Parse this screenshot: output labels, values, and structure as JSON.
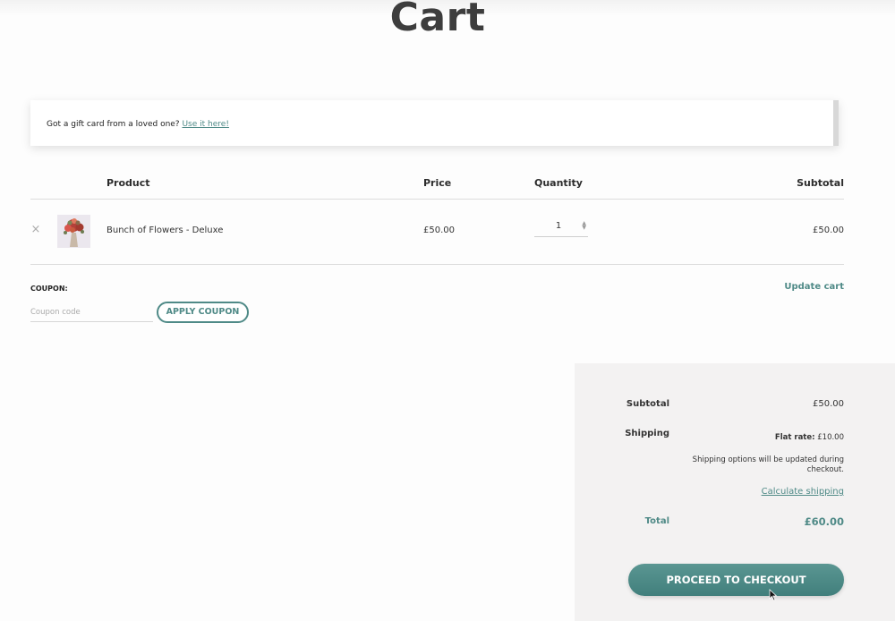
{
  "page": {
    "title": "Cart"
  },
  "notice": {
    "text": "Got a gift card from a loved one?",
    "link": "Use it here!"
  },
  "table": {
    "headers": {
      "product": "Product",
      "price": "Price",
      "quantity": "Quantity",
      "subtotal": "Subtotal"
    },
    "rows": [
      {
        "remove": "×",
        "image_icon": "flower-bouquet-thumbnail",
        "product": "Bunch of Flowers - Deluxe",
        "price": "£50.00",
        "quantity": "1",
        "subtotal": "£50.00"
      }
    ]
  },
  "coupon": {
    "label": "COUPON:",
    "placeholder": "Coupon code",
    "apply_label": "APPLY COUPON"
  },
  "update_cart_label": "Update cart",
  "totals": {
    "subtotal_label": "Subtotal",
    "subtotal_value": "£50.00",
    "shipping_label": "Shipping",
    "flat_rate_label": "Flat rate:",
    "flat_rate_value": "£10.00",
    "shipping_note_line1": "Shipping options will be updated during",
    "shipping_note_line2": "checkout.",
    "calculate_shipping": "Calculate shipping",
    "total_label": "Total",
    "total_value": "£60.00",
    "checkout_label": "PROCEED TO CHECKOUT"
  },
  "colors": {
    "accent": "#4f8a87",
    "panel": "#f3f2f2"
  }
}
